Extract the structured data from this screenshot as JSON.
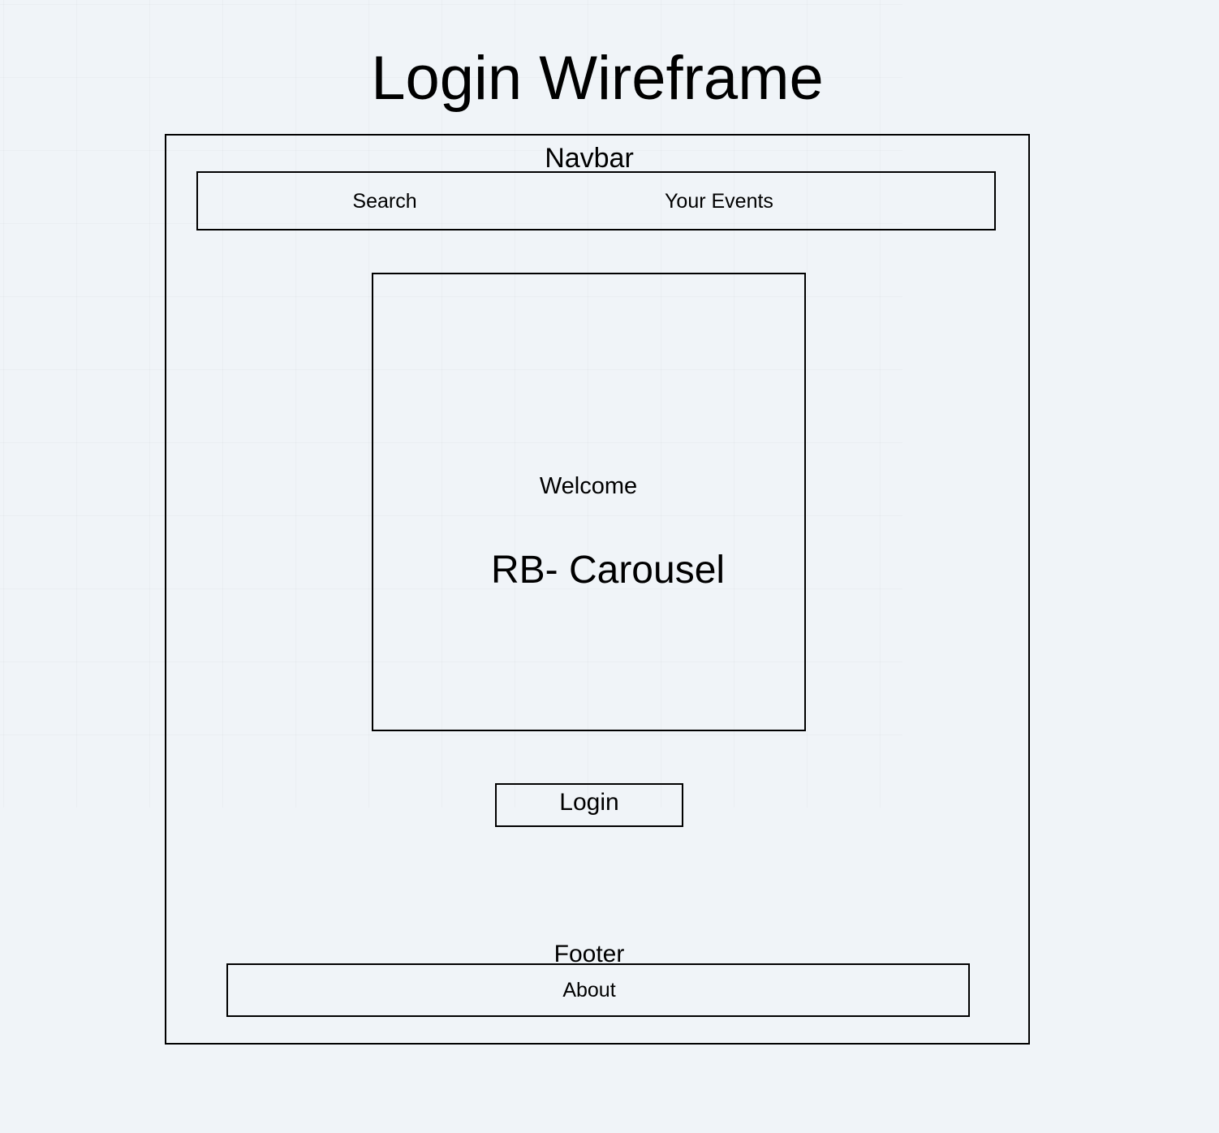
{
  "title": "Login Wireframe",
  "navbar": {
    "label": "Navbar",
    "items": [
      {
        "label": "Search"
      },
      {
        "label": "Your Events"
      }
    ]
  },
  "carousel": {
    "welcome": "Welcome",
    "label": "RB- Carousel"
  },
  "login": {
    "label": "Login"
  },
  "footer": {
    "label": "Footer",
    "items": [
      {
        "label": "About"
      }
    ]
  }
}
